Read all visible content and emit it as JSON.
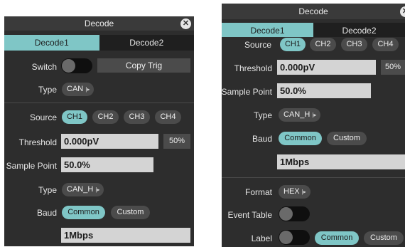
{
  "left": {
    "title": "Decode",
    "tabs": [
      "Decode1",
      "Decode2"
    ],
    "switch_label": "Switch",
    "copy_trig": "Copy Trig",
    "type_label": "Type",
    "type_value": "CAN",
    "source_label": "Source",
    "sources": [
      "CH1",
      "CH2",
      "CH3",
      "CH4"
    ],
    "threshold_label": "Threshold",
    "threshold_value": "0.000pV",
    "pct": "50%",
    "sample_label": "Sample Point",
    "sample_value": "50.0%",
    "type2_label": "Type",
    "type2_value": "CAN_H",
    "baud_label": "Baud",
    "baud_common": "Common",
    "baud_custom": "Custom",
    "baud_value": "1Mbps"
  },
  "right": {
    "title": "Decode",
    "tabs": [
      "Decode1",
      "Decode2"
    ],
    "source_label": "Source",
    "sources": [
      "CH1",
      "CH2",
      "CH3",
      "CH4"
    ],
    "threshold_label": "Threshold",
    "threshold_value": "0.000pV",
    "pct": "50%",
    "sample_label": "Sample Point",
    "sample_value": "50.0%",
    "type_label": "Type",
    "type_value": "CAN_H",
    "baud_label": "Baud",
    "baud_common": "Common",
    "baud_custom": "Custom",
    "baud_value": "1Mbps",
    "format_label": "Format",
    "format_value": "HEX",
    "event_label": "Event Table",
    "label_label": "Label",
    "label_common": "Common",
    "label_custom": "Custom"
  },
  "icons": {
    "close": "close-icon",
    "dropdown": "dropdown-caret-icon"
  },
  "colors": {
    "accent": "#7fc6c6",
    "panel": "#2d2d2d",
    "field": "#d4d4d4"
  }
}
